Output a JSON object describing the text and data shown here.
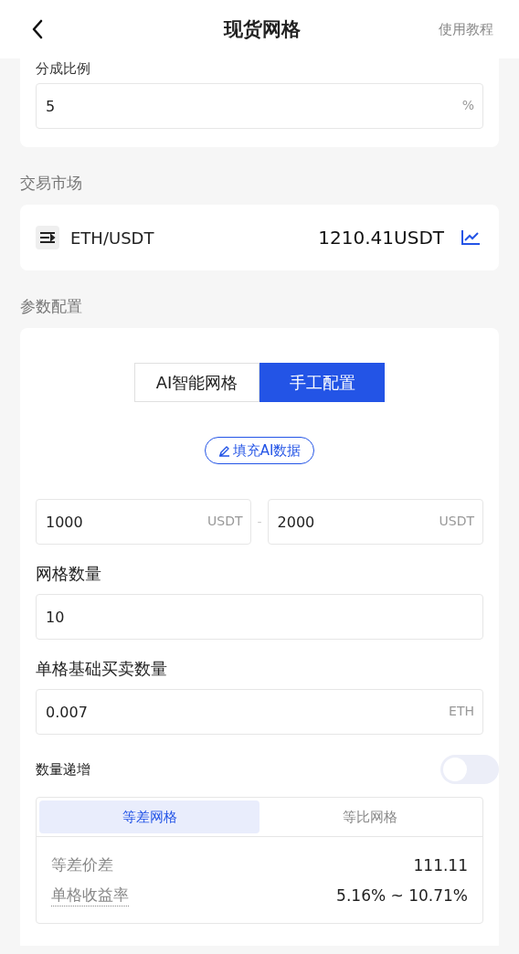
{
  "header": {
    "title": "现货网格",
    "action": "使用教程"
  },
  "commission": {
    "label": "分成比例",
    "value": "5",
    "unit": "%"
  },
  "market_section": {
    "title": "交易市场",
    "pair": "ETH/USDT",
    "price": "1210.41USDT"
  },
  "params_section": {
    "title": "参数配置",
    "modes": [
      {
        "label": "AI智能网格",
        "selected": false
      },
      {
        "label": "手工配置",
        "selected": true
      }
    ],
    "fill_button": "填充AI数据",
    "range": {
      "low": {
        "value": "1000",
        "unit": "USDT"
      },
      "separator": "-",
      "high": {
        "value": "2000",
        "unit": "USDT"
      }
    },
    "grid_count": {
      "label": "网格数量",
      "value": "10"
    },
    "amount": {
      "label": "单格基础买卖数量",
      "value": "0.007",
      "unit": "ETH"
    },
    "increment": {
      "label": "数量递增",
      "on": false
    },
    "grid_types": [
      {
        "label": "等差网格",
        "selected": true
      },
      {
        "label": "等比网格",
        "selected": false
      }
    ],
    "stats": [
      {
        "label": "等差价差",
        "value": "111.11",
        "dotted": false
      },
      {
        "label": "单格收益率",
        "value": "5.16% ~ 10.71%",
        "dotted": true
      }
    ]
  }
}
